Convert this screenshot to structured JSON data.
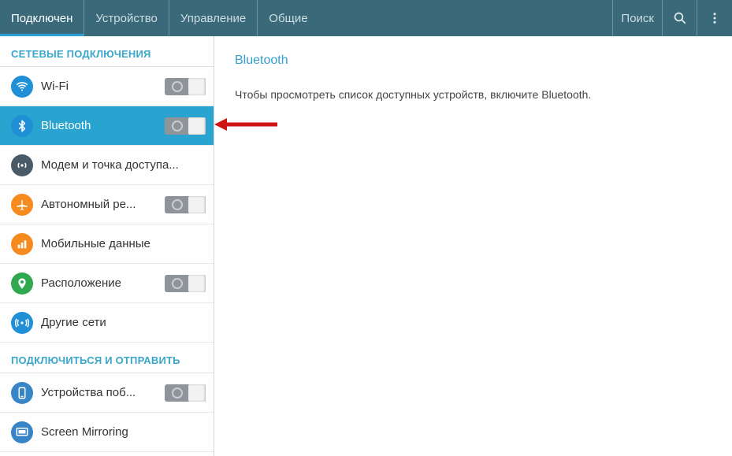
{
  "topbar": {
    "tabs": [
      {
        "label": "Подключен",
        "active": true
      },
      {
        "label": "Устройство",
        "active": false
      },
      {
        "label": "Управление",
        "active": false
      },
      {
        "label": "Общие",
        "active": false
      }
    ],
    "search_label": "Поиск"
  },
  "sidebar": {
    "section1_title": "СЕТЕВЫЕ ПОДКЛЮЧЕНИЯ",
    "section2_title": "ПОДКЛЮЧИТЬСЯ И ОТПРАВИТЬ",
    "items1": [
      {
        "label": "Wi-Fi",
        "icon": "wifi",
        "color": "#1f8fd6",
        "toggle": true,
        "selected": false
      },
      {
        "label": "Bluetooth",
        "icon": "bluetooth",
        "color": "#1f8fd6",
        "toggle": true,
        "selected": true
      },
      {
        "label": "Модем и точка доступа...",
        "icon": "hotspot",
        "color": "#4a5a66",
        "toggle": false,
        "selected": false
      },
      {
        "label": "Автономный ре...",
        "icon": "airplane",
        "color": "#f58a1f",
        "toggle": true,
        "selected": false
      },
      {
        "label": "Мобильные данные",
        "icon": "data",
        "color": "#f58a1f",
        "toggle": false,
        "selected": false
      },
      {
        "label": "Расположение",
        "icon": "location",
        "color": "#2fa84f",
        "toggle": true,
        "selected": false
      },
      {
        "label": "Другие сети",
        "icon": "network",
        "color": "#1f8fd6",
        "toggle": false,
        "selected": false
      }
    ],
    "items2": [
      {
        "label": "Устройства поб...",
        "icon": "nearby",
        "color": "#3784c7",
        "toggle": true,
        "selected": false
      },
      {
        "label": "Screen Mirroring",
        "icon": "mirror",
        "color": "#3784c7",
        "toggle": false,
        "selected": false
      }
    ]
  },
  "content": {
    "title": "Bluetooth",
    "text": "Чтобы просмотреть список доступных устройств, включите Bluetooth."
  },
  "colors": {
    "accent": "#29a3cf",
    "header": "#3a6a7a"
  }
}
